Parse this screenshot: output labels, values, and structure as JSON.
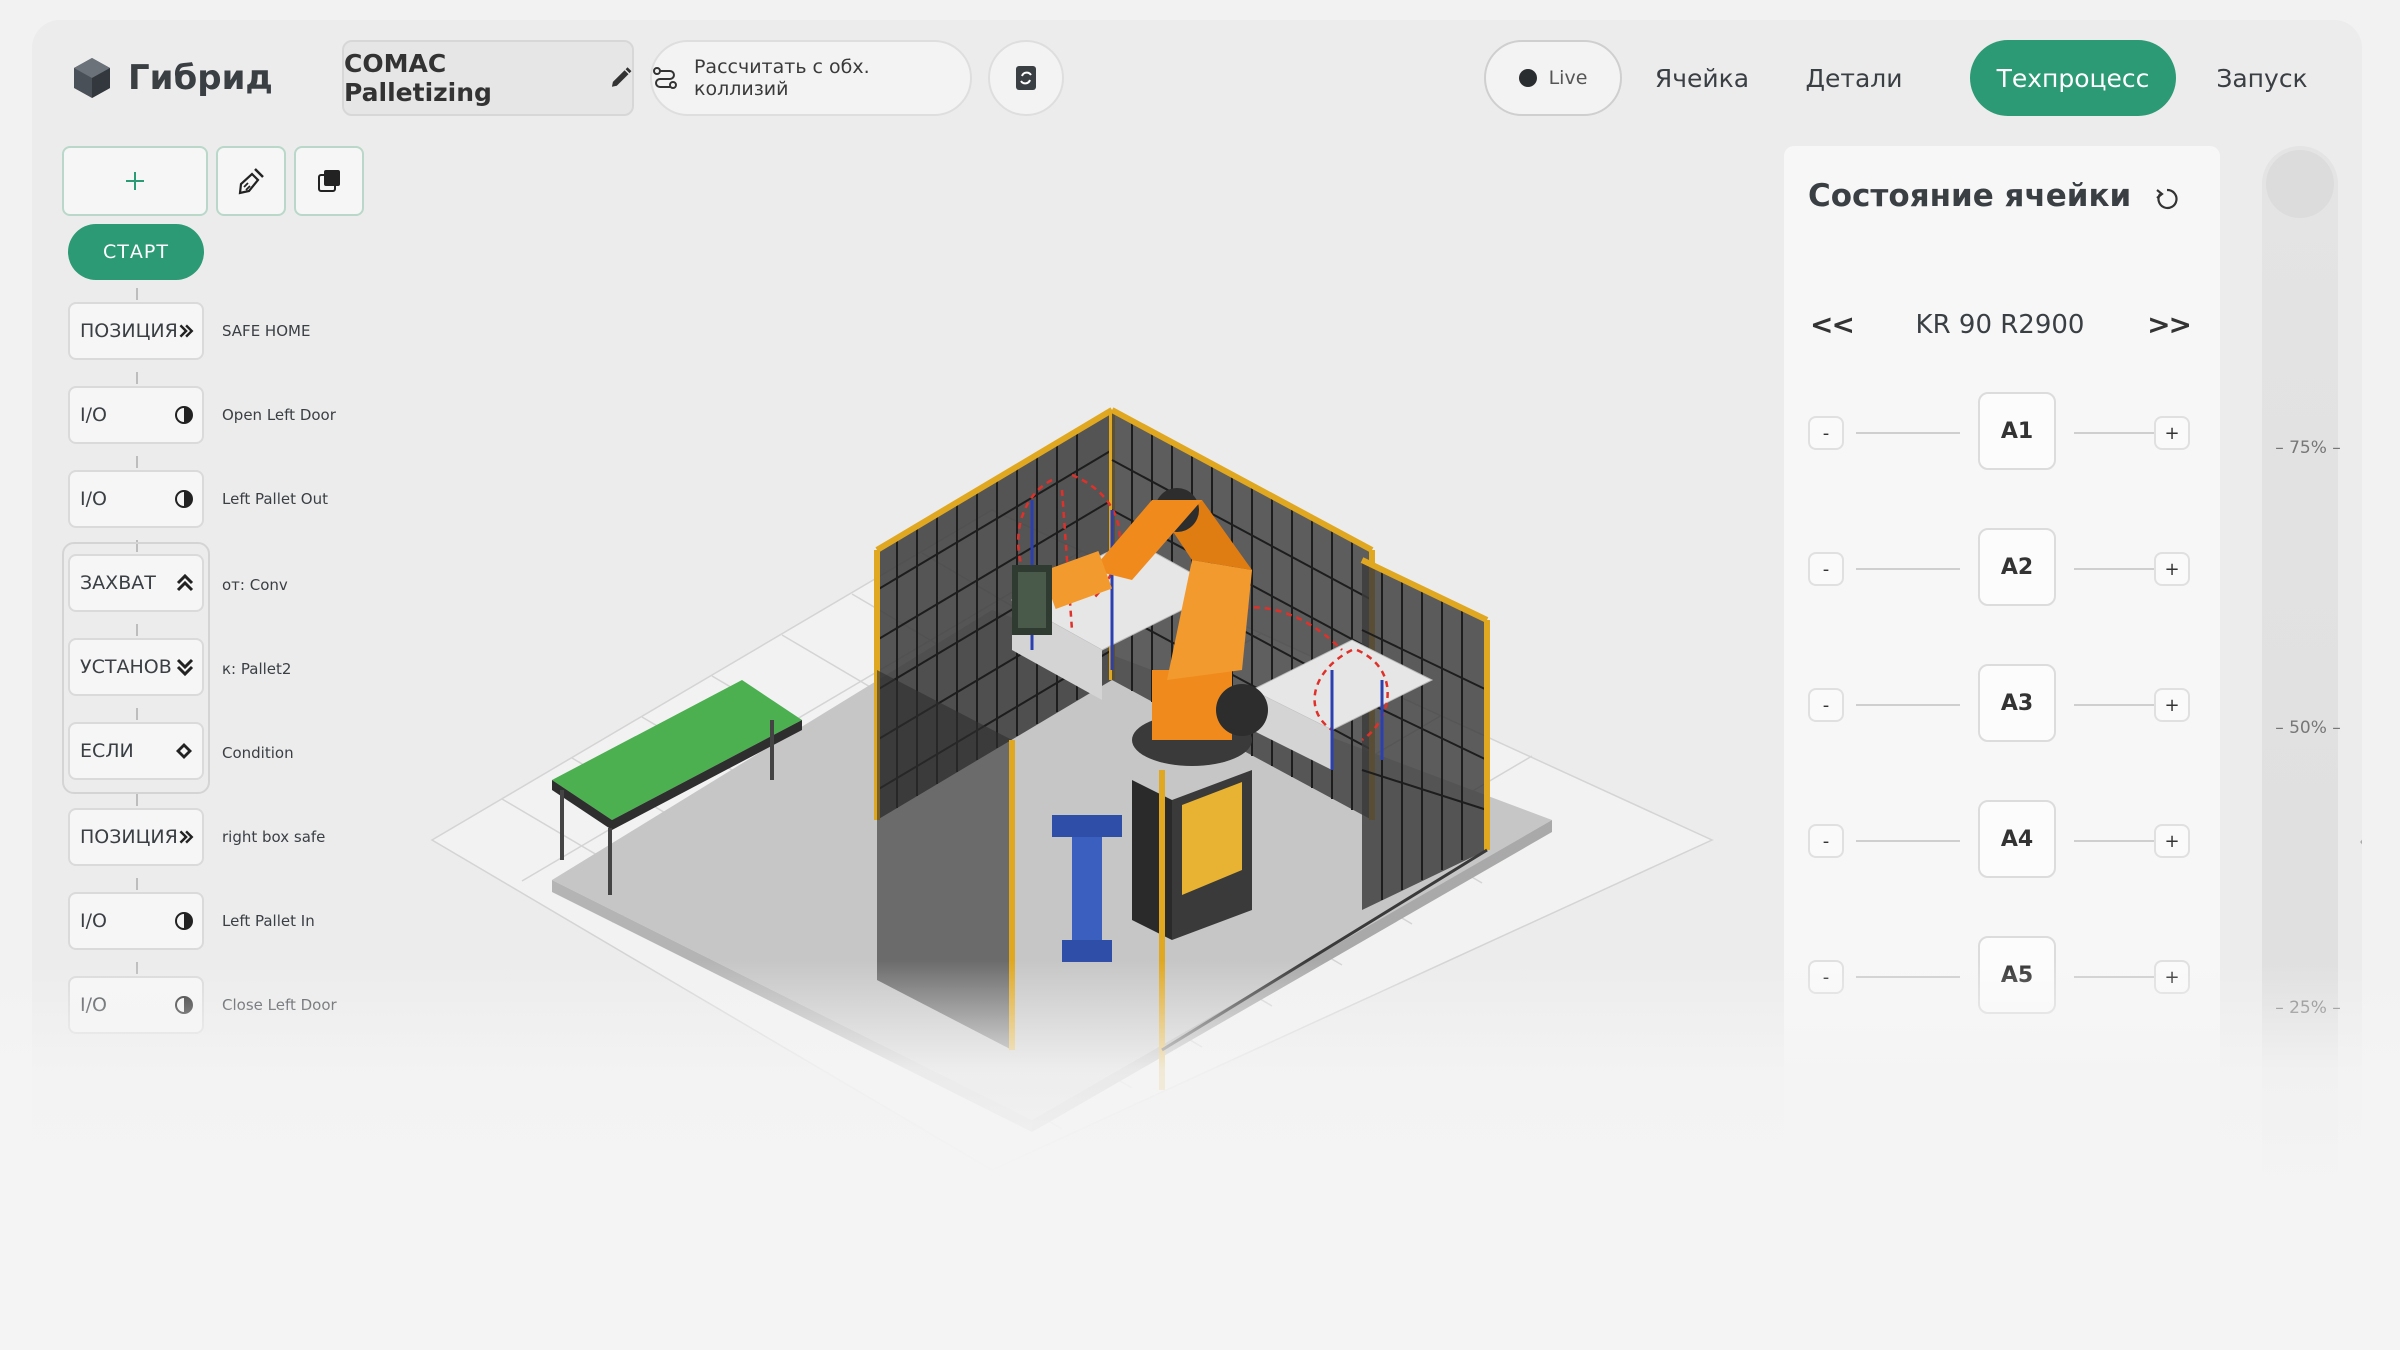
{
  "app": {
    "logo_text": "Гибрид"
  },
  "header": {
    "project_name": "COMAC Palletizing",
    "calc_label": "Рассчитать с обх. коллизий",
    "live_label": "Live",
    "nav": [
      {
        "label": "Ячейка",
        "active": false
      },
      {
        "label": "Детали",
        "active": false
      },
      {
        "label": "Техпроцесс",
        "active": true
      },
      {
        "label": "Запуск",
        "active": false
      }
    ]
  },
  "toolbar": {
    "add_icon": "plus-icon",
    "clean_icon": "broom-icon",
    "layers_icon": "layers-icon"
  },
  "program": {
    "start_label": "СТАРТ",
    "steps": [
      {
        "type": "ПОЗИЦИЯ",
        "icon": "double-chevron-right-icon",
        "label": "SAFE HOME"
      },
      {
        "type": "I/O",
        "icon": "half-circle-icon",
        "label": "Open Left Door"
      },
      {
        "type": "I/O",
        "icon": "half-circle-icon",
        "label": "Left Pallet Out"
      },
      {
        "type": "ЗАХВАТ",
        "icon": "double-chevron-up-icon",
        "label": "от: Conv"
      },
      {
        "type": "УСТАНОВ",
        "icon": "double-chevron-down-icon",
        "label": "к: Pallet2"
      },
      {
        "type": "ЕСЛИ",
        "icon": "diamond-icon",
        "label": "Condition"
      },
      {
        "type": "ПОЗИЦИЯ",
        "icon": "double-chevron-right-icon",
        "label": "right box safe"
      },
      {
        "type": "I/O",
        "icon": "half-circle-icon",
        "label": "Left Pallet In"
      },
      {
        "type": "I/O",
        "icon": "half-circle-icon",
        "label": "Close Left Door"
      }
    ]
  },
  "cell_state": {
    "title": "Состояние ячейки",
    "prev_label": "<<",
    "next_label": ">>",
    "robot": "KR 90 R2900",
    "minus_label": "-",
    "plus_label": "+",
    "axes": [
      "A1",
      "A2",
      "A3",
      "A4",
      "A5"
    ]
  },
  "zoom": {
    "ticks": [
      "75%",
      "50%",
      "25%"
    ]
  },
  "colors": {
    "accent": "#2c9a74",
    "robot": "#f08a1c",
    "fence": "#e0a820",
    "conveyor": "#4caf50"
  }
}
